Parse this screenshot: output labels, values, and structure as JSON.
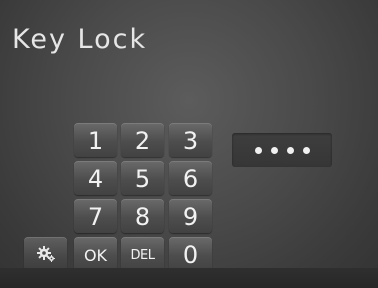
{
  "screen": {
    "title": "Key Lock"
  },
  "keypad": {
    "keys": {
      "k1": "1",
      "k2": "2",
      "k3": "3",
      "k4": "4",
      "k5": "5",
      "k6": "6",
      "k7": "7",
      "k8": "8",
      "k9": "9",
      "k0": "0",
      "ok": "OK",
      "del": "DEL"
    },
    "settings_icon": "gear-icon"
  },
  "code_display": {
    "entered_digits": 4
  }
}
